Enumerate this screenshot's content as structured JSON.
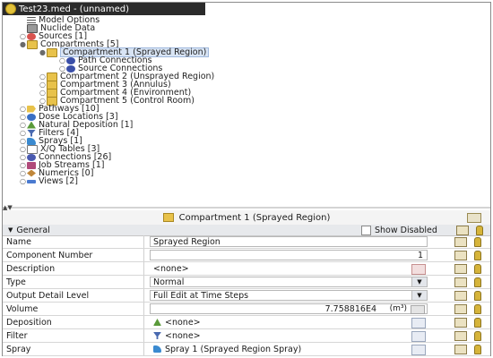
{
  "window": {
    "title": "Test23.med - (unnamed)"
  },
  "tree": {
    "items": [
      {
        "label": "Model Options",
        "icon": "list-icon",
        "color": "#555555"
      },
      {
        "label": "Nuclide Data",
        "icon": "grid-icon",
        "color": "#555555"
      },
      {
        "label": "Sources [1]",
        "icon": "source-icon",
        "color": "#d9534f"
      },
      {
        "label": "Compartments [5]",
        "icon": "folder-icon",
        "color": "#e8c24a"
      },
      {
        "label": "Compartment 1 (Sprayed Region)",
        "icon": "compartment-icon",
        "color": "#e8c24a",
        "selected": true
      },
      {
        "label": "Path Connections",
        "icon": "connection-icon",
        "color": "#3a4fa8"
      },
      {
        "label": "Source Connections",
        "icon": "connection-icon",
        "color": "#3a4fa8"
      },
      {
        "label": "Compartment 2 (Unsprayed Region)",
        "icon": "compartment-icon",
        "color": "#e8c24a"
      },
      {
        "label": "Compartment 3 (Annulus)",
        "icon": "compartment-icon",
        "color": "#e8c24a"
      },
      {
        "label": "Compartment 4 (Environment)",
        "icon": "compartment-icon",
        "color": "#e8c24a"
      },
      {
        "label": "Compartment 5 (Control Room)",
        "icon": "compartment-icon",
        "color": "#e8c24a"
      },
      {
        "label": "Pathways [10]",
        "icon": "pathway-icon",
        "color": "#e8c24a"
      },
      {
        "label": "Dose Locations [3]",
        "icon": "dose-icon",
        "color": "#3a6fc4"
      },
      {
        "label": "Natural Deposition [1]",
        "icon": "deposition-icon",
        "color": "#5a9a3a"
      },
      {
        "label": "Filters [4]",
        "icon": "filter-icon",
        "color": "#4a6ab0"
      },
      {
        "label": "Sprays [1]",
        "icon": "spray-icon",
        "color": "#3a8ad0"
      },
      {
        "label": "X/Q Tables [3]",
        "icon": "table-icon",
        "color": "#777777"
      },
      {
        "label": "Connections [26]",
        "icon": "connections-icon",
        "color": "#4a5ab0"
      },
      {
        "label": "Job Streams [1]",
        "icon": "jobstream-icon",
        "color": "#b04a7a"
      },
      {
        "label": "Numerics [0]",
        "icon": "numerics-icon",
        "color": "#c0873a"
      },
      {
        "label": "Views [2]",
        "icon": "views-icon",
        "color": "#4a7ad0"
      }
    ]
  },
  "panel": {
    "title": "Compartment 1 (Sprayed Region)",
    "group": "General",
    "show_disabled": "Show Disabled",
    "rows": [
      {
        "name": "Name",
        "value": "Sprayed Region"
      },
      {
        "name": "Component Number",
        "value": "1"
      },
      {
        "name": "Description",
        "value": "<none>"
      },
      {
        "name": "Type",
        "value": "Normal"
      },
      {
        "name": "Output Detail Level",
        "value": "Full Edit at Time Steps"
      },
      {
        "name": "Volume",
        "value": "7.758816E4",
        "unit": "(m³)"
      },
      {
        "name": "Deposition",
        "value": "<none>"
      },
      {
        "name": "Filter",
        "value": "<none>"
      },
      {
        "name": "Spray",
        "value": "Spray 1 (Sprayed Region Spray)"
      }
    ]
  }
}
